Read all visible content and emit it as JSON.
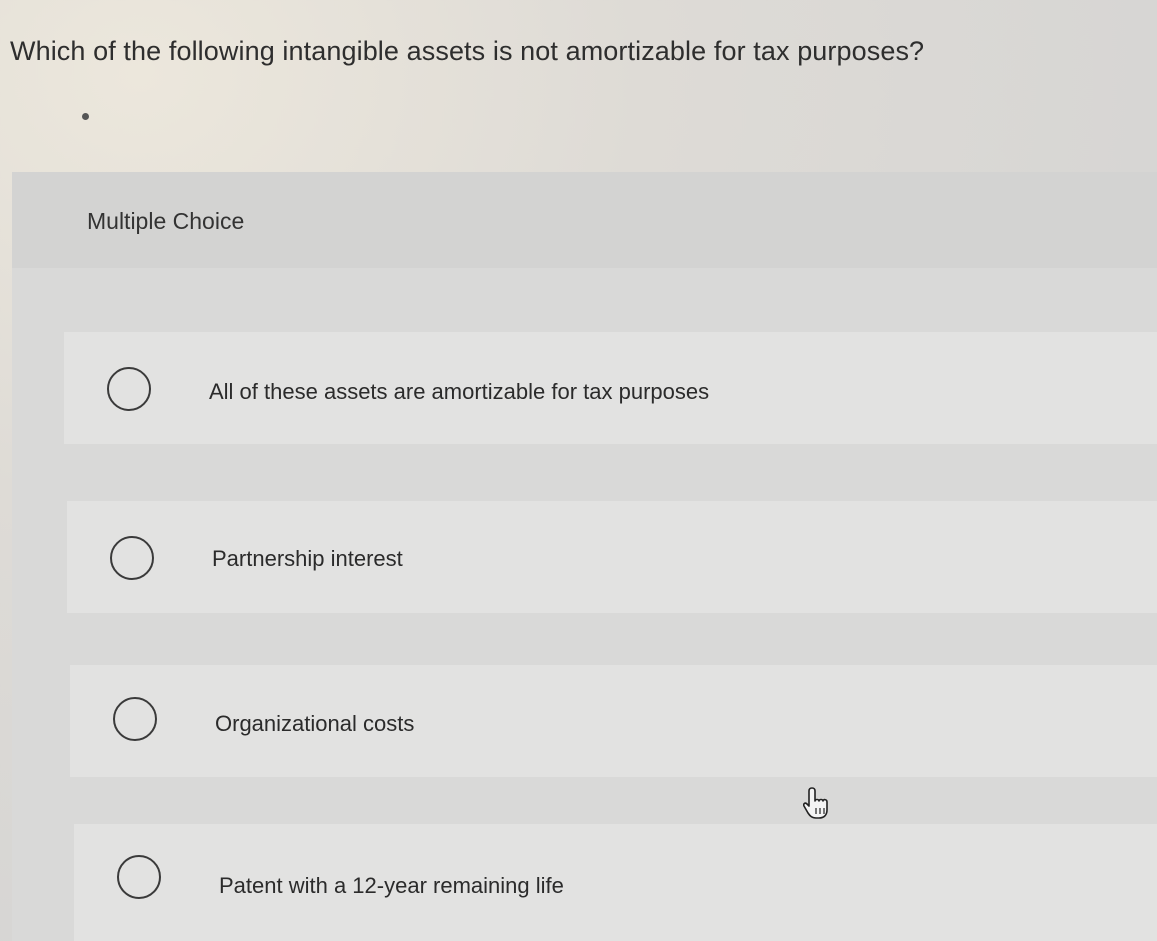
{
  "question": {
    "text": "Which of the following intangible assets is not amortizable for tax purposes?"
  },
  "panel": {
    "label": "Multiple Choice"
  },
  "options": [
    {
      "label": "All of these assets are amortizable for tax purposes",
      "selected": false
    },
    {
      "label": "Partnership interest",
      "selected": false
    },
    {
      "label": "Organizational costs",
      "selected": false
    },
    {
      "label": "Patent with a 12-year remaining life",
      "selected": false
    }
  ],
  "cursor": {
    "icon": "hand-pointer-icon"
  },
  "colors": {
    "radio_border": "#3a3a3a",
    "option_bg": "#e2e2e1",
    "panel_bg": "#d9d9d8"
  }
}
